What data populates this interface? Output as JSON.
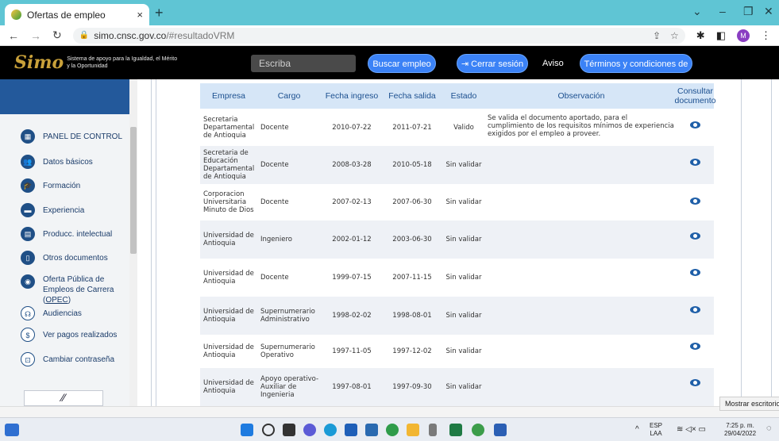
{
  "browser": {
    "tab_title": "Ofertas de empleo",
    "tab_close": "×",
    "new_tab": "+",
    "url_host": "simo.cnsc.gov.co",
    "url_path": "/#resultadoVRM",
    "profile_initial": "M"
  },
  "header": {
    "logo_text": "Simo",
    "logo_tagline": "Sistema de apoyo para la Igualdad, el Mérito y la Oportunidad",
    "search_placeholder": "Escriba",
    "buscar_label": "Buscar empleo",
    "cerrar_label": "Cerrar sesión",
    "aviso_label": "Aviso",
    "terminos_label": "Términos y condiciones de uso"
  },
  "sidebar": {
    "items": [
      {
        "label": "PANEL DE CONTROL",
        "icon": "dashboard-icon"
      },
      {
        "label": "Datos básicos",
        "icon": "people-icon"
      },
      {
        "label": "Formación",
        "icon": "graduation-icon"
      },
      {
        "label": "Experiencia",
        "icon": "briefcase-icon"
      },
      {
        "label": "Producc. intelectual",
        "icon": "book-icon"
      },
      {
        "label": "Otros documentos",
        "icon": "document-icon"
      },
      {
        "label": "Oferta Pública de",
        "label2": "Empleos de Carrera (",
        "label2_link": "OPEC",
        "label2_end": ")",
        "icon": "globe-icon"
      },
      {
        "label": "Audiencias",
        "icon": "audience-icon"
      },
      {
        "label": "Ver pagos realizados",
        "icon": "dollar-icon"
      },
      {
        "label": "Cambiar contraseña",
        "icon": "lock-icon"
      }
    ]
  },
  "table": {
    "headers": [
      "Empresa",
      "Cargo",
      "Fecha ingreso",
      "Fecha salida",
      "Estado",
      "Observación",
      "Consultar documento"
    ],
    "rows": [
      {
        "empresa": "Secretaria Departamental de Antioquia",
        "cargo": "Docente",
        "ingreso": "2010-07-22",
        "salida": "2011-07-21",
        "estado": "Valido",
        "observacion": "Se valida el documento aportado, para el cumplimiento de los requisitos mínimos de experiencia exigidos por el empleo a proveer."
      },
      {
        "empresa": "Secretaria de Educación Departamental de Antioquia",
        "cargo": "Docente",
        "ingreso": "2008-03-28",
        "salida": "2010-05-18",
        "estado": "Sin validar",
        "observacion": ""
      },
      {
        "empresa": "Corporacion Universitaria Minuto de Dios",
        "cargo": "Docente",
        "ingreso": "2007-02-13",
        "salida": "2007-06-30",
        "estado": "Sin validar",
        "observacion": ""
      },
      {
        "empresa": "Universidad de Antioquia",
        "cargo": "Ingeniero",
        "ingreso": "2002-01-12",
        "salida": "2003-06-30",
        "estado": "Sin validar",
        "observacion": ""
      },
      {
        "empresa": "Universidad de Antioquia",
        "cargo": "Docente",
        "ingreso": "1999-07-15",
        "salida": "2007-11-15",
        "estado": "Sin validar",
        "observacion": ""
      },
      {
        "empresa": "Universidad de Antioquia",
        "cargo": "Supernumerario Administrativo",
        "ingreso": "1998-02-02",
        "salida": "1998-08-01",
        "estado": "Sin validar",
        "observacion": ""
      },
      {
        "empresa": "Universidad de Antioquia",
        "cargo": "Supernumerario Operativo",
        "ingreso": "1997-11-05",
        "salida": "1997-12-02",
        "estado": "Sin validar",
        "observacion": ""
      },
      {
        "empresa": "Universidad de Antioquia",
        "cargo": "Apoyo operativo-Auxiliar de Ingenieria",
        "ingreso": "1997-08-01",
        "salida": "1997-09-30",
        "estado": "Sin validar",
        "observacion": ""
      }
    ]
  },
  "tooltip": "Mostrar escritorio",
  "taskbar": {
    "lang": "ESP",
    "lang2": "LAA",
    "time": "7:25 p. m.",
    "date": "29/04/2022"
  },
  "colors": {
    "accent": "#3b82f6",
    "header_bg": "#000000",
    "tab_strip": "#5fc5d4",
    "table_head": "#d6e6f7",
    "sidebar_blue": "#23599b"
  }
}
